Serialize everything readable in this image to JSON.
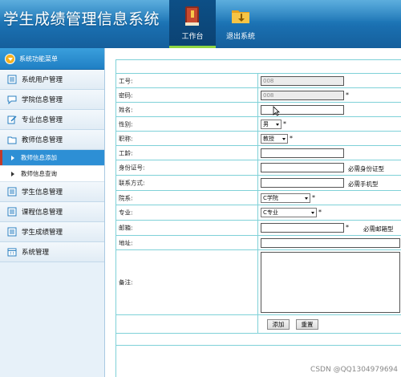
{
  "header": {
    "title": "学生成绩管理信息系统",
    "nav": [
      {
        "label": "工作台",
        "icon": "book-icon",
        "active": true
      },
      {
        "label": "退出系统",
        "icon": "exit-folder-icon",
        "active": false
      }
    ]
  },
  "sidebar": {
    "header": "系统功能菜单",
    "items": [
      {
        "label": "系统用户管理"
      },
      {
        "label": "学院信息管理"
      },
      {
        "label": "专业信息管理"
      },
      {
        "label": "教师信息管理"
      }
    ],
    "sub_items": [
      {
        "label": "教师信息添加",
        "active": true
      },
      {
        "label": "教师信息查询",
        "active": false
      }
    ],
    "items_after": [
      {
        "label": "学生信息管理"
      },
      {
        "label": "课程信息管理"
      },
      {
        "label": "学生成绩管理"
      },
      {
        "label": "系统管理"
      }
    ]
  },
  "form": {
    "fields": {
      "id_label": "工号:",
      "id_value": "008",
      "password_label": "密码:",
      "password_value": "008",
      "name_label": "姓名:",
      "gender_label": "性别:",
      "gender_value": "男",
      "title_label": "职称:",
      "title_value": "教授",
      "seniority_label": "工龄:",
      "idcard_label": "身份证号:",
      "idcard_hint": "必需身份证型",
      "contact_label": "联系方式:",
      "contact_hint": "必需手机型",
      "college_label": "院系:",
      "college_value": "C学院",
      "major_label": "专业:",
      "major_value": "C专业",
      "email_label": "邮箱:",
      "email_hint": "必需邮箱型",
      "address_label": "地址:",
      "remark_label": "备注:"
    },
    "required_mark": "*",
    "buttons": {
      "add": "添加",
      "reset": "重置"
    }
  },
  "watermark": "CSDN @QQ1304979694"
}
